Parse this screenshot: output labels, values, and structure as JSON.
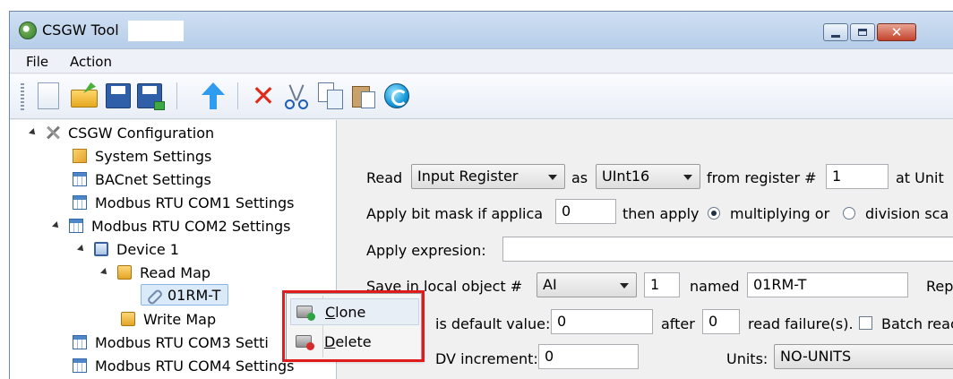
{
  "window": {
    "title": "CSGW Tool"
  },
  "menu": {
    "file": "File",
    "action": "Action"
  },
  "tree": {
    "root": "CSGW Configuration",
    "system_settings": "System Settings",
    "bacnet_settings": "BACnet Settings",
    "rtu_com1": "Modbus RTU COM1 Settings",
    "rtu_com2": "Modbus RTU COM2 Settings",
    "device1": "Device 1",
    "read_map": "Read Map",
    "selected_item": "01RM-T",
    "write_map": "Write Map",
    "rtu_com3": "Modbus RTU COM3 Setti",
    "rtu_com4": "Modbus RTU COM4 Settings"
  },
  "form": {
    "read_label": "Read",
    "register_type": "Input Register",
    "as_label": "as",
    "data_type": "UInt16",
    "from_register_label": "from register #",
    "from_register_value": "1",
    "at_unit_label": "at Unit",
    "bitmask_label": "Apply bit mask if applica",
    "bitmask_value": "0",
    "then_apply_label": "then apply",
    "multiplying_label": "multiplying or",
    "division_label": "division sca",
    "expression_label": "Apply expresion:",
    "expression_value": "",
    "save_label": "Save in local object #",
    "object_type": "AI",
    "object_number": "1",
    "named_label": "named",
    "object_name": "01RM-T",
    "rep_label": "Rep",
    "default_value_label": "is default value:",
    "default_value": "0",
    "after_label": "after",
    "after_value": "0",
    "read_failures_label": "read failure(s).",
    "batch_read_label": "Batch reac",
    "cov_label": "DV increment:",
    "cov_value": "0",
    "units_label": "Units:",
    "units_value": "NO-UNITS"
  },
  "context_menu": {
    "clone_first": "C",
    "clone_rest": "lone",
    "delete_first": "D",
    "delete_rest": "elete"
  }
}
